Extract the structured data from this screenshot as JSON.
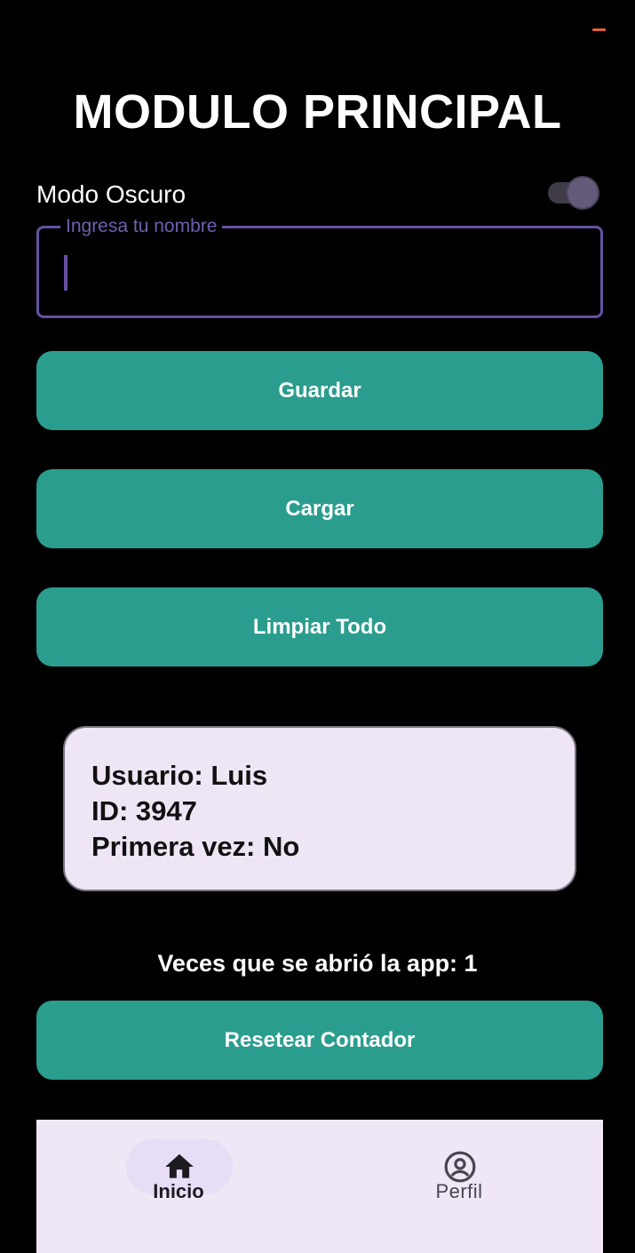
{
  "header": {
    "title": "MODULO PRINCIPAL"
  },
  "settings": {
    "dark_mode_label": "Modo Oscuro",
    "dark_mode_on": true
  },
  "name_field": {
    "label": "Ingresa tu nombre",
    "value": ""
  },
  "actions": {
    "save_label": "Guardar",
    "load_label": "Cargar",
    "clear_label": "Limpiar Todo",
    "reset_label": "Resetear Contador"
  },
  "info_card": {
    "user_line": "Usuario: Luis",
    "id_line": "ID: 3947",
    "first_time_line": "Primera vez: No"
  },
  "counter": {
    "text": "Veces que se abrió la app: 1"
  },
  "bottom_nav": {
    "items": [
      {
        "label": "Inicio",
        "icon": "home-icon",
        "selected": true
      },
      {
        "label": "Perfil",
        "icon": "account-circle-icon",
        "selected": false
      }
    ]
  },
  "colors": {
    "background": "#000000",
    "button": "#2a9d8f",
    "field_border": "#6650a4",
    "card_background": "#efe6f5",
    "nav_background": "#f0e7f6",
    "status_indicator": "#e0623a"
  }
}
